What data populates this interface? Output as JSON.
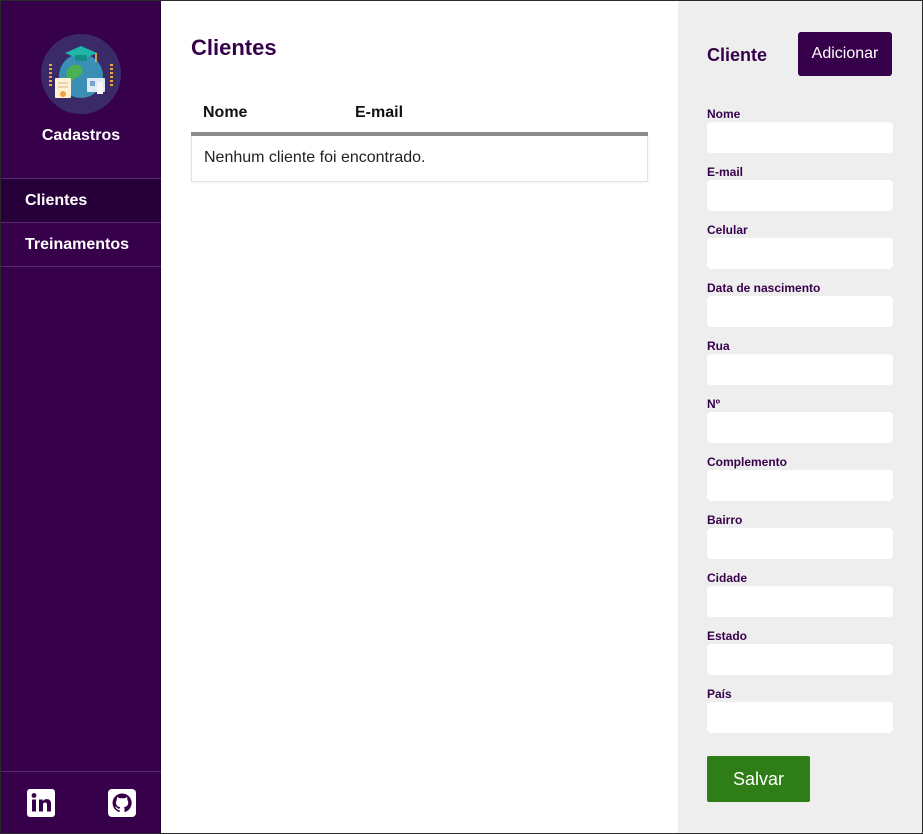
{
  "sidebar": {
    "brand": "Cadastros",
    "items": [
      {
        "label": "Clientes",
        "active": true
      },
      {
        "label": "Treinamentos",
        "active": false
      }
    ],
    "social": [
      "linkedin-icon",
      "github-icon"
    ]
  },
  "main": {
    "title": "Clientes",
    "table": {
      "columns": [
        "Nome",
        "E-mail"
      ],
      "empty_message": "Nenhum cliente foi encontrado."
    }
  },
  "panel": {
    "title": "Cliente",
    "add_label": "Adicionar",
    "fields": [
      {
        "label": "Nome",
        "value": ""
      },
      {
        "label": "E-mail",
        "value": ""
      },
      {
        "label": "Celular",
        "value": ""
      },
      {
        "label": "Data de nascimento",
        "value": ""
      },
      {
        "label": "Rua",
        "value": ""
      },
      {
        "label": "Nº",
        "value": ""
      },
      {
        "label": "Complemento",
        "value": ""
      },
      {
        "label": "Bairro",
        "value": ""
      },
      {
        "label": "Cidade",
        "value": ""
      },
      {
        "label": "Estado",
        "value": ""
      },
      {
        "label": "País",
        "value": ""
      }
    ],
    "save_label": "Salvar"
  },
  "colors": {
    "sidebar_bg": "#37004a",
    "active_item_bg": "#27003a",
    "accent": "#37004a",
    "save_button": "#2e7d16",
    "panel_bg": "#eeeeee"
  }
}
